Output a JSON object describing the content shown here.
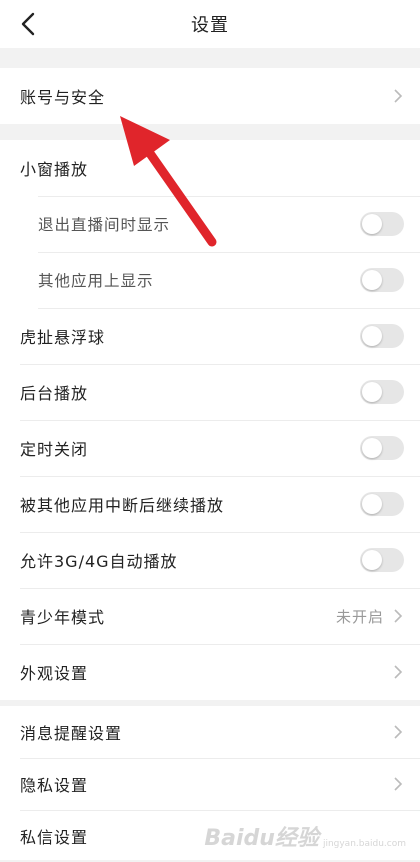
{
  "header": {
    "title": "设置",
    "back_icon": "chevron-left-icon"
  },
  "section_account": {
    "label": "账号与安全"
  },
  "section_main": {
    "items": [
      {
        "label": "小窗播放",
        "type": "header"
      },
      {
        "label": "退出直播间时显示",
        "type": "toggle",
        "on": false
      },
      {
        "label": "其他应用上显示",
        "type": "toggle",
        "on": false
      },
      {
        "label": "虎扯悬浮球",
        "type": "toggle",
        "on": false
      },
      {
        "label": "后台播放",
        "type": "toggle",
        "on": false
      },
      {
        "label": "定时关闭",
        "type": "toggle",
        "on": false
      },
      {
        "label": "被其他应用中断后继续播放",
        "type": "toggle",
        "on": false
      },
      {
        "label": "允许3G/4G自动播放",
        "type": "toggle",
        "on": false
      },
      {
        "label": "青少年模式",
        "type": "link",
        "value": "未开启"
      },
      {
        "label": "外观设置",
        "type": "link"
      }
    ]
  },
  "section_more": {
    "items": [
      {
        "label": "消息提醒设置"
      },
      {
        "label": "隐私设置"
      },
      {
        "label": "私信设置"
      }
    ]
  },
  "watermark": {
    "text": "Baidu经验",
    "sub": "jingyan.baidu.com"
  },
  "colors": {
    "annotation_arrow": "#e0252b",
    "toggle_off": "#e6e6e6"
  }
}
